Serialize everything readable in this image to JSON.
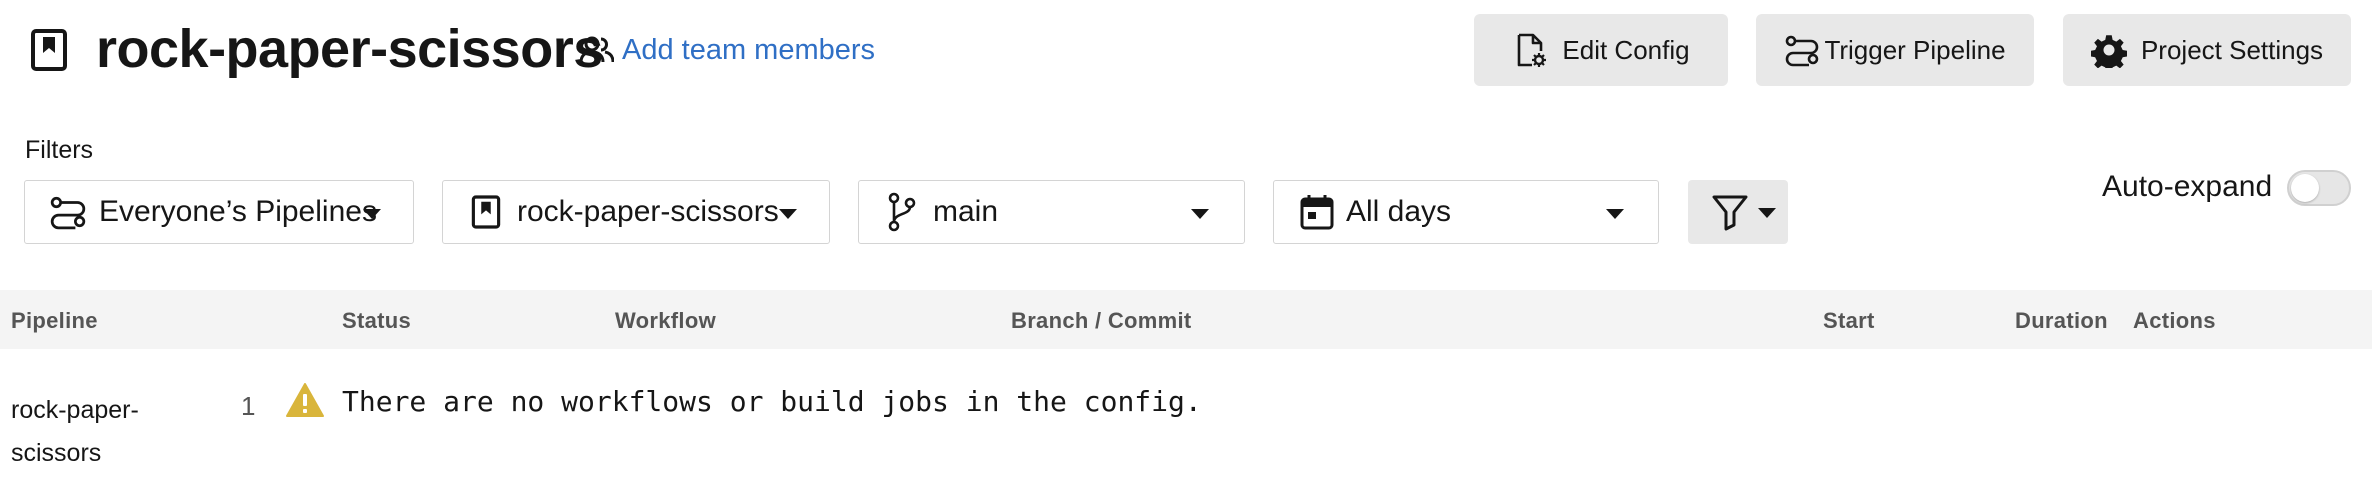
{
  "header": {
    "project_title": "rock-paper-scissors",
    "add_team_label": "Add team members",
    "edit_config_label": "Edit Config",
    "trigger_pipeline_label": "Trigger Pipeline",
    "project_settings_label": "Project Settings",
    "link_color": "#2f6fc5"
  },
  "filters": {
    "label": "Filters",
    "pipelines_value": "Everyone’s Pipelines",
    "project_value": "rock-paper-scissors",
    "branch_value": "main",
    "days_value": "All days",
    "auto_expand_label": "Auto-expand",
    "auto_expand_on": false
  },
  "table": {
    "columns": [
      "Pipeline",
      "Status",
      "Workflow",
      "Branch / Commit",
      "Start",
      "Duration",
      "Actions"
    ],
    "rows": [
      {
        "pipeline": "rock-paper-scissors",
        "number": "1",
        "status_icon": "warning-icon",
        "message": "There are no workflows or build jobs in the config."
      }
    ]
  },
  "icons": {
    "project": "bookmark-icon",
    "team": "people-icon",
    "edit_config": "file-gear-icon",
    "trigger": "pipeline-icon",
    "settings": "gear-icon",
    "branch": "git-branch-icon",
    "calendar": "calendar-icon",
    "filter": "funnel-icon"
  },
  "colors": {
    "warning": "#d9b53b",
    "button_bg": "#e8e8e8",
    "header_row_bg": "#f4f4f4"
  }
}
